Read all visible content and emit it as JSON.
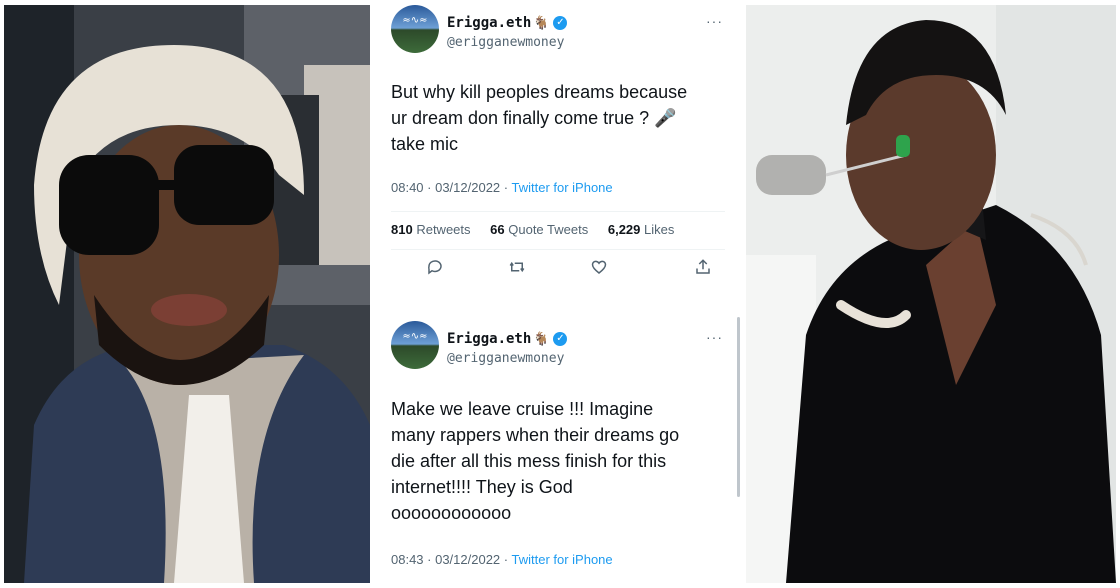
{
  "tweets": [
    {
      "name": "Erigga.eth",
      "handle": "@erigganewmoney",
      "text_lines": [
        "But why kill peoples dreams because",
        "ur dream don finally come true ? 🎤",
        "take mic"
      ],
      "time": "08:40 · 03/12/2022 ·",
      "source": "Twitter for iPhone",
      "retweets": "810",
      "retweets_label": "Retweets",
      "quotes": "66",
      "quotes_label": "Quote Tweets",
      "likes": "6,229",
      "likes_label": "Likes",
      "more": "···"
    },
    {
      "name": "Erigga.eth",
      "handle": "@erigganewmoney",
      "text_lines": [
        "Make we leave cruise !!! Imagine",
        "many rappers when their dreams go",
        "die after all this mess finish for this",
        "internet!!!! They is God",
        "oooooooooooo"
      ],
      "time": "08:43 · 03/12/2022 ·",
      "source": "Twitter for iPhone",
      "more": "···"
    }
  ],
  "icons": {
    "reply": "reply-icon",
    "retweet": "retweet-icon",
    "like": "like-icon",
    "share": "share-icon",
    "verified": "verified-icon"
  },
  "colors": {
    "accent": "#1d9bf0",
    "text": "#0f1419",
    "muted": "#536471"
  }
}
